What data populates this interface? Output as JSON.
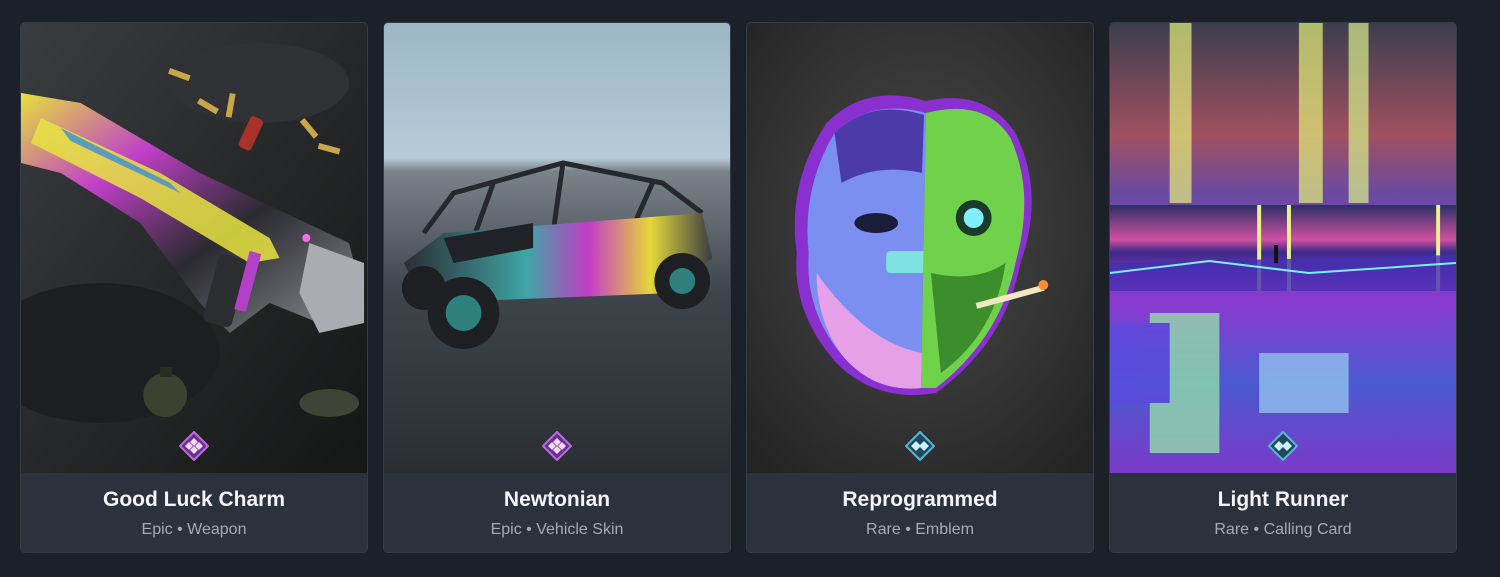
{
  "cards": [
    {
      "name": "Good Luck Charm",
      "rarity": "Epic",
      "category": "Weapon",
      "separator": "•",
      "rarity_color": "#b86ee0",
      "art_icon": "rifle-art"
    },
    {
      "name": "Newtonian",
      "rarity": "Epic",
      "category": "Vehicle Skin",
      "separator": "•",
      "rarity_color": "#b86ee0",
      "art_icon": "buggy-vehicle-art"
    },
    {
      "name": "Reprogrammed",
      "rarity": "Rare",
      "category": "Emblem",
      "separator": "•",
      "rarity_color": "#5ab6d8",
      "art_icon": "cyborg-face-emblem-art"
    },
    {
      "name": "Light Runner",
      "rarity": "Rare",
      "category": "Calling Card",
      "separator": "•",
      "rarity_color": "#5ab6d8",
      "art_icon": "neon-cityscape-calling-card-art"
    }
  ]
}
